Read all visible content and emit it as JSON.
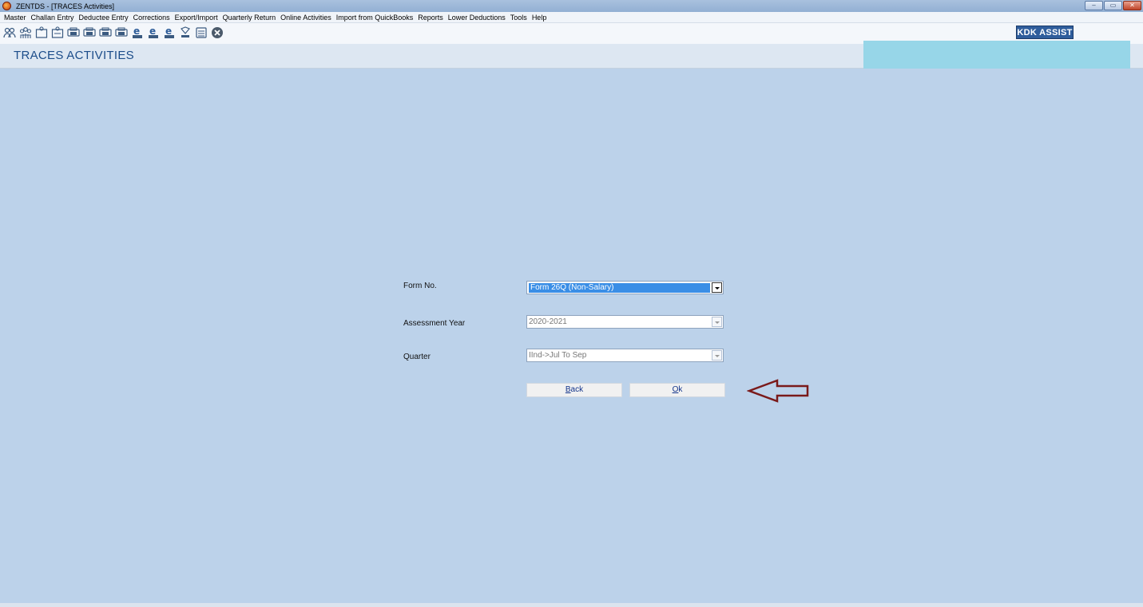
{
  "window": {
    "title": "ZENTDS - [TRACES Activities]",
    "controls": [
      "–",
      "▭",
      "✕"
    ]
  },
  "menu": [
    "Master",
    "Challan Entry",
    "Deductee Entry",
    "Corrections",
    "Export/Import",
    "Quarterly Return",
    "Online Activities",
    "Import from QuickBooks",
    "Reports",
    "Lower Deductions",
    "Tools",
    "Help"
  ],
  "toolbar": {
    "icons": [
      "users-icon",
      "group-icon",
      "form-icon",
      "form-alt-icon",
      "print-24q-icon",
      "print-26q-icon",
      "print-27q-icon",
      "print-27eq-icon",
      "e-24q-icon",
      "e-26q-icon",
      "e-27q-icon",
      "tds-icon",
      "document-icon",
      "close-icon"
    ],
    "assist_label": "KDK ASSIST"
  },
  "header": {
    "title": "TRACES ACTIVITIES"
  },
  "form": {
    "form_no": {
      "label": "Form No.",
      "value": "Form 26Q (Non-Salary)"
    },
    "assessment_year": {
      "label": "Assessment Year",
      "value": "2020-2021"
    },
    "quarter": {
      "label": "Quarter",
      "value": "IInd->Jul To Sep"
    },
    "back_button": {
      "accel": "B",
      "rest": "ack"
    },
    "ok_button": {
      "accel": "O",
      "rest": "k"
    }
  },
  "colors": {
    "background": "#bcd2ea",
    "accent": "#3a8ee6",
    "arrow": "#7a1a1a",
    "assist": "#2f5d9c"
  }
}
